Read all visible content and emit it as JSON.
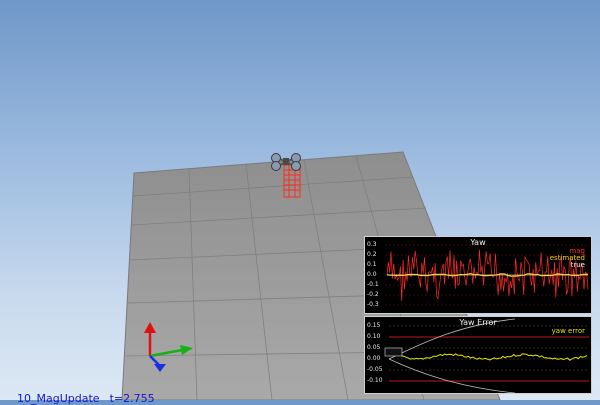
{
  "status": {
    "scenario": "10_MagUpdate",
    "time": "t=2.755"
  },
  "colors": {
    "mag": "#ff2a2a",
    "estimated": "#ffd000",
    "true": "#f0f0f0",
    "yaw_error": "#e6e600",
    "status_text": "#1515d0"
  },
  "icons": {
    "drone": "quadcopter-icon",
    "axes": "xyz-axes-icon"
  },
  "plots": {
    "yaw": {
      "title": "Yaw",
      "yticks": [
        "0.3",
        "0.2",
        "0.1",
        "0.0",
        "-0.1",
        "-0.2",
        "-0.3"
      ],
      "legend": {
        "mag": "mag",
        "estimated": "estimated",
        "true": "true"
      }
    },
    "yaw_error": {
      "title": "Yaw Error",
      "yticks": [
        "0.15",
        "0.10",
        "0.05",
        "0.00",
        "-0.05",
        "-0.10"
      ],
      "legend": {
        "yaw_error": "yaw error"
      }
    }
  }
}
